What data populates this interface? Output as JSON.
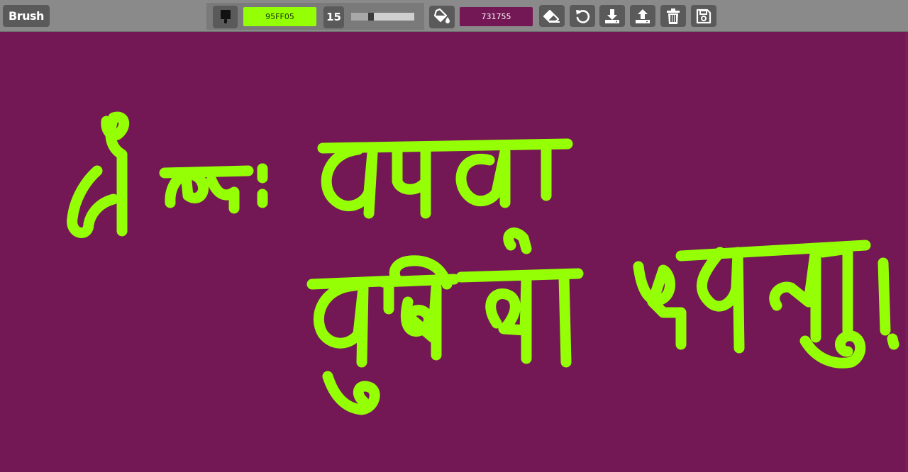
{
  "toolbar": {
    "tool_label": "Brush",
    "brush_color_hex": "95FF05",
    "brush_size": "15",
    "brush_size_fraction": 0.31,
    "fill_color_hex": "731755",
    "icons": {
      "brush": "paintbrush-icon",
      "fill": "paint-bucket-icon",
      "eraser": "eraser-icon",
      "undo": "undo-icon",
      "download": "download-icon",
      "upload": "upload-icon",
      "clear": "trash-icon",
      "save": "save-icon"
    }
  },
  "colors": {
    "canvas_background": "#731755",
    "stroke_color": "#95FF05",
    "toolbar_background": "#8a8a8a",
    "button_background": "#5a5a5a"
  },
  "drawing": {
    "handwritten_text": "लोकाः समस्ता सुखिनो भवन्तु!"
  }
}
